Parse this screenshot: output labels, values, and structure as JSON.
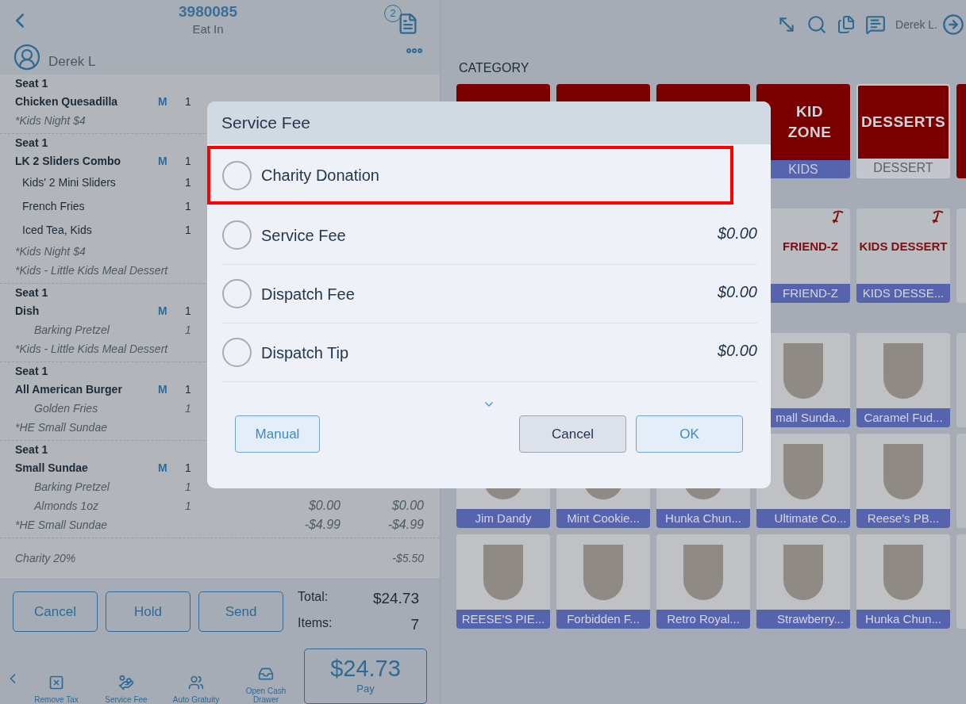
{
  "order_header": {
    "order_number": "3980085",
    "order_type": "Eat In",
    "badge": "2"
  },
  "server": {
    "name": "Derek L"
  },
  "order_lines": [
    {
      "kind": "seat",
      "text": "Seat 1"
    },
    {
      "kind": "item",
      "text": "Chicken Quesadilla",
      "flag": "M",
      "qty": "1"
    },
    {
      "kind": "note",
      "text": "*Kids Night $4"
    },
    {
      "kind": "seat",
      "text": "Seat 1"
    },
    {
      "kind": "item",
      "text": "LK 2 Sliders Combo",
      "flag": "M",
      "qty": "1"
    },
    {
      "kind": "modifier",
      "text": "Kids' 2 Mini Sliders",
      "qty": "1"
    },
    {
      "kind": "modifier",
      "text": "French Fries",
      "qty": "1"
    },
    {
      "kind": "modifier",
      "text": "Iced Tea, Kids",
      "qty": "1"
    },
    {
      "kind": "note",
      "text": "*Kids Night $4"
    },
    {
      "kind": "note",
      "text": "*Kids - Little Kids Meal Dessert"
    },
    {
      "kind": "seat",
      "text": "Seat 1"
    },
    {
      "kind": "item",
      "text": "Dish",
      "flag": "M",
      "qty": "1"
    },
    {
      "kind": "sub",
      "text": "Barking Pretzel",
      "qty": "1"
    },
    {
      "kind": "note",
      "text": "*Kids - Little Kids Meal Dessert"
    },
    {
      "kind": "seat",
      "text": "Seat 1"
    },
    {
      "kind": "item",
      "text": "All American Burger",
      "flag": "M",
      "qty": "1"
    },
    {
      "kind": "sub",
      "text": "Golden Fries",
      "qty": "1"
    },
    {
      "kind": "note",
      "text": "*HE Small Sundae"
    },
    {
      "kind": "seat",
      "text": "Seat 1"
    },
    {
      "kind": "item",
      "text": "Small Sundae",
      "flag": "M",
      "qty": "1"
    },
    {
      "kind": "sub",
      "text": "Barking Pretzel",
      "qty": "1"
    },
    {
      "kind": "sub",
      "text": "Almonds 1oz",
      "qty": "1",
      "price": "$0.00",
      "total": "$0.00"
    },
    {
      "kind": "note",
      "text": "*HE Small Sundae",
      "price": "-$4.99",
      "total": "-$4.99"
    }
  ],
  "discount": {
    "label": "Charity 20%",
    "amount": "-$5.50"
  },
  "actions": [
    "Cancel",
    "Hold",
    "Send"
  ],
  "totals": {
    "total_label": "Total:",
    "total": "$24.73",
    "items_label": "Items:",
    "items": "7"
  },
  "tools": [
    {
      "kind": "remove_tax",
      "label": "Remove Tax"
    },
    {
      "kind": "service_fee",
      "label": "Service Fee"
    },
    {
      "kind": "auto_gratuity",
      "label": "Auto Gratuity"
    },
    {
      "kind": "cash_drawer",
      "label": "Open Cash Drawer"
    }
  ],
  "pay": {
    "amount": "$24.73",
    "label": "Pay"
  },
  "user": "Derek L.",
  "category": {
    "title": "CATEGORY",
    "tiles": [
      {
        "logo": "KID ZONE",
        "label": "KIDS",
        "selected": false
      },
      {
        "logo": "DESSERTS",
        "label": "DESSERT",
        "selected": true
      }
    ]
  },
  "item_rows": [
    [
      {
        "kind": "logo",
        "logo": "FRIEND-Z",
        "label": "FRIEND-Z"
      },
      {
        "kind": "logo",
        "logo": "KIDS DESSERT",
        "label": "KIDS DESSE..."
      }
    ],
    [
      {
        "kind": "photo",
        "label": "mall Sunda..."
      },
      {
        "kind": "photo",
        "label": "Caramel Fud..."
      }
    ],
    [
      {
        "kind": "photo",
        "label": "Jim Dandy"
      },
      {
        "kind": "photo",
        "label": "Mint Cookie..."
      },
      {
        "kind": "photo",
        "label": "Hunka Chun..."
      },
      {
        "kind": "photo",
        "label": "Ultimate Co..."
      },
      {
        "kind": "photo",
        "label": "Reese's PB..."
      }
    ],
    [
      {
        "kind": "photo",
        "label": "REESE'S PIE..."
      },
      {
        "kind": "photo",
        "label": "Forbidden F..."
      },
      {
        "kind": "photo",
        "label": "Retro Royal..."
      },
      {
        "kind": "photo",
        "label": "Strawberry..."
      },
      {
        "kind": "photo",
        "label": "Hunka Chun..."
      }
    ]
  ],
  "dialog": {
    "title": "Service Fee",
    "options": [
      {
        "label": "Charity Donation",
        "selected": false,
        "highlighted": true
      },
      {
        "label": "Service Fee",
        "amount": "$0.00",
        "selected": false,
        "highlighted": false
      },
      {
        "label": "Dispatch Fee",
        "amount": "$0.00",
        "selected": false,
        "highlighted": false
      },
      {
        "label": "Dispatch Tip",
        "amount": "$0.00",
        "selected": false,
        "highlighted": false
      }
    ],
    "buttons": {
      "manual": "Manual",
      "cancel": "Cancel",
      "ok": "OK"
    }
  }
}
